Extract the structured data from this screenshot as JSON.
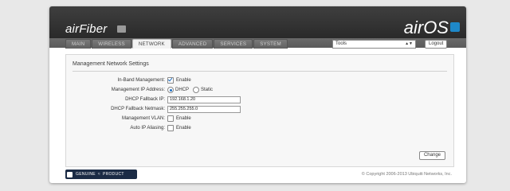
{
  "brand": {
    "product": "airFiber",
    "os": "airOS"
  },
  "tabs": [
    {
      "label": "MAIN"
    },
    {
      "label": "WIRELESS"
    },
    {
      "label": "NETWORK"
    },
    {
      "label": "ADVANCED"
    },
    {
      "label": "SERVICES"
    },
    {
      "label": "SYSTEM"
    }
  ],
  "active_tab": "NETWORK",
  "toolbar": {
    "tools_value": "Tools",
    "logout_label": "Logout"
  },
  "section": {
    "title": "Management Network Settings",
    "rows": {
      "inband": {
        "label": "In-Band Management:",
        "checkbox_label": "Enable",
        "checked": true
      },
      "mgmt_ip": {
        "label": "Management IP Address:",
        "option_dhcp": "DHCP",
        "option_static": "Static",
        "selected": "DHCP"
      },
      "fallback_ip": {
        "label": "DHCP Fallback IP:",
        "value": "192.168.1.20"
      },
      "fallback_netmask": {
        "label": "DHCP Fallback Netmask:",
        "value": "255.255.255.0"
      },
      "mgmt_vlan": {
        "label": "Management VLAN:",
        "checkbox_label": "Enable",
        "checked": false
      },
      "auto_ip": {
        "label": "Auto IP Aliasing:",
        "checkbox_label": "Enable",
        "checked": false
      }
    }
  },
  "actions": {
    "change_label": "Change"
  },
  "footer": {
    "badge_genuine": "GENUINE",
    "badge_product": "PRODUCT",
    "copyright": "© Copyright 2006-2013 Ubiquiti Networks, Inc."
  }
}
